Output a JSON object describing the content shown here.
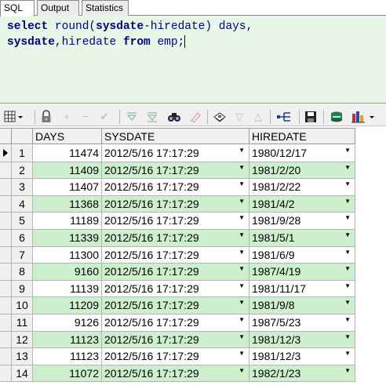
{
  "tabs": [
    {
      "label": "SQL",
      "active": true
    },
    {
      "label": "Output",
      "active": false
    },
    {
      "label": "Statistics",
      "active": false
    }
  ],
  "editor": {
    "line1": {
      "kw1": "select",
      "t1": " ",
      "fn1": "round(",
      "kw2": "sysdate",
      "t2": "-hiredate)",
      "t3": " days,"
    },
    "line2": {
      "kw1": "sysdate",
      "t1": ",hiredate ",
      "kw2": "from",
      "t2": " emp;"
    }
  },
  "toolbar": {
    "icons": [
      "grid-menu-icon",
      "lock-icon",
      "add-record-icon",
      "delete-record-icon",
      "post-edit-icon",
      "filter-icon",
      "clear-filter-icon",
      "find-icon",
      "clear-icon",
      "print-icon",
      "sort-down-icon",
      "sort-up-icon",
      "explain-plan-icon",
      "save-icon",
      "export-icon",
      "chart-icon"
    ]
  },
  "grid": {
    "columns": [
      "DAYS",
      "SYSDATE",
      "HIREDATE"
    ],
    "rows": [
      {
        "n": "1",
        "days": "11474",
        "sysdate": "2012/5/16 17:17:29",
        "hiredate": "1980/12/17"
      },
      {
        "n": "2",
        "days": "11409",
        "sysdate": "2012/5/16 17:17:29",
        "hiredate": "1981/2/20"
      },
      {
        "n": "3",
        "days": "11407",
        "sysdate": "2012/5/16 17:17:29",
        "hiredate": "1981/2/22"
      },
      {
        "n": "4",
        "days": "11368",
        "sysdate": "2012/5/16 17:17:29",
        "hiredate": "1981/4/2"
      },
      {
        "n": "5",
        "days": "11189",
        "sysdate": "2012/5/16 17:17:29",
        "hiredate": "1981/9/28"
      },
      {
        "n": "6",
        "days": "11339",
        "sysdate": "2012/5/16 17:17:29",
        "hiredate": "1981/5/1"
      },
      {
        "n": "7",
        "days": "11300",
        "sysdate": "2012/5/16 17:17:29",
        "hiredate": "1981/6/9"
      },
      {
        "n": "8",
        "days": "9160",
        "sysdate": "2012/5/16 17:17:29",
        "hiredate": "1987/4/19"
      },
      {
        "n": "9",
        "days": "11139",
        "sysdate": "2012/5/16 17:17:29",
        "hiredate": "1981/11/17"
      },
      {
        "n": "10",
        "days": "11209",
        "sysdate": "2012/5/16 17:17:29",
        "hiredate": "1981/9/8"
      },
      {
        "n": "11",
        "days": "9126",
        "sysdate": "2012/5/16 17:17:29",
        "hiredate": "1987/5/23"
      },
      {
        "n": "12",
        "days": "11123",
        "sysdate": "2012/5/16 17:17:29",
        "hiredate": "1981/12/3"
      },
      {
        "n": "13",
        "days": "11123",
        "sysdate": "2012/5/16 17:17:29",
        "hiredate": "1981/12/3"
      },
      {
        "n": "14",
        "days": "11072",
        "sysdate": "2012/5/16 17:17:29",
        "hiredate": "1982/1/23"
      }
    ]
  }
}
